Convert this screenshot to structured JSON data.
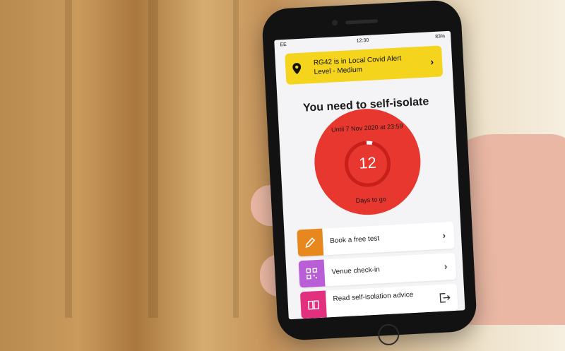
{
  "status_bar": {
    "carrier": "EE",
    "time": "12:30",
    "battery": "83%"
  },
  "alert_banner": {
    "text": "RG42 is in Local Covid Alert Level - Medium",
    "accent": "#f4d41d"
  },
  "isolation": {
    "headline": "You need to self-isolate",
    "until": "Until 7 Nov 2020 at 23:59",
    "days_count": "12",
    "days_label": "Days to go",
    "accent": "#e8372f"
  },
  "actions": [
    {
      "label": "Book a free test",
      "icon": "pencil-icon",
      "color": "#e8871e"
    },
    {
      "label": "Venue check-in",
      "icon": "qr-code-icon",
      "color": "#b95ed6"
    },
    {
      "label": "Read self-isolation advice",
      "icon": "book-icon",
      "color": "#e2307e"
    }
  ]
}
